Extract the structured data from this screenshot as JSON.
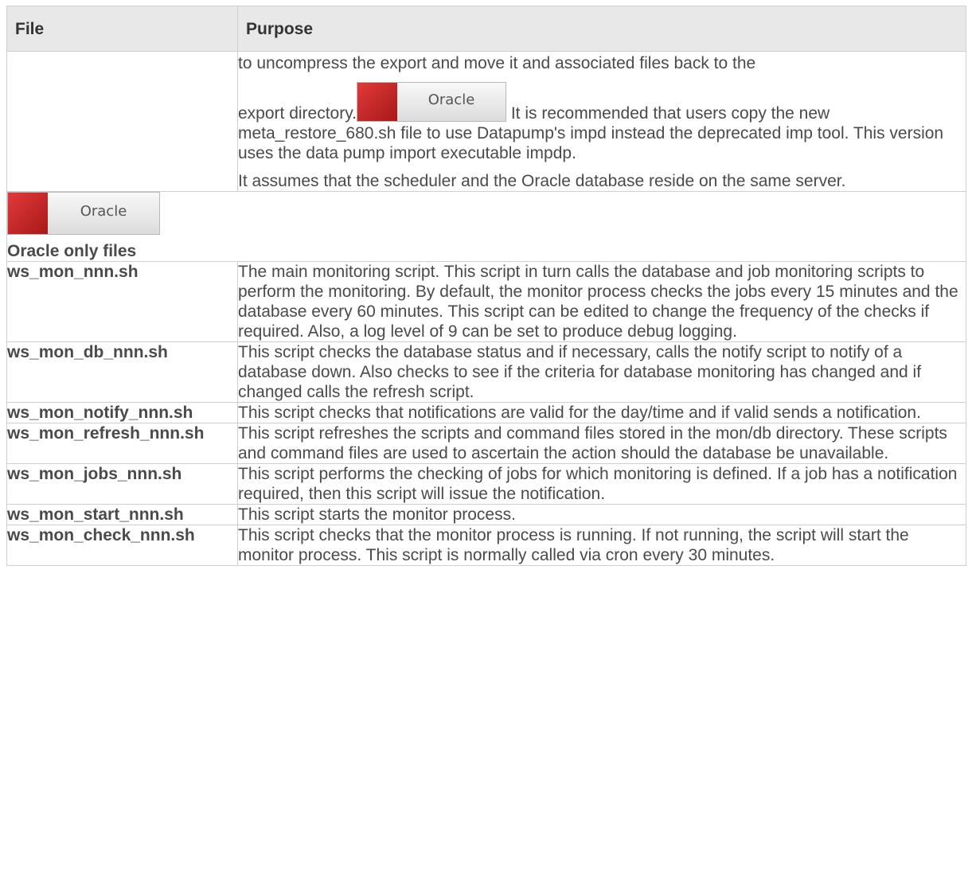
{
  "header": {
    "col_file": "File",
    "col_purpose": "Purpose"
  },
  "first_row": {
    "line1": "to uncompress the export and move it and associated files back to the",
    "before_badge": "export directory.",
    "after_badge": " It is recommended that users copy the new meta_restore_680.sh file to use Datapump's impd instead the deprecated imp tool. This version uses the data pump import executable impdp.",
    "para2": "It assumes that the scheduler and the Oracle database reside on the same server."
  },
  "badge": {
    "label": "Oracle",
    "red": "#c62828"
  },
  "section": {
    "title": "Oracle only files"
  },
  "rows": [
    {
      "file": "ws_mon_nnn.sh",
      "purpose": "The main monitoring script. This script in turn calls the database and job monitoring scripts to perform the monitoring. By default, the monitor process checks the jobs every 15 minutes and the database every 60 minutes. This script can be edited to change the frequency of the checks if required. Also, a log level of 9 can be set to produce debug logging."
    },
    {
      "file": "ws_mon_db_nnn.sh",
      "purpose": "This script checks the database status and if necessary, calls the notify script to notify of a database down. Also checks to see if the criteria for database monitoring has changed and if changed calls the refresh script."
    },
    {
      "file": "ws_mon_notify_nnn.sh",
      "purpose": "This script checks that notifications are valid for the day/time and if valid sends a notification."
    },
    {
      "file": "ws_mon_refresh_nnn.sh",
      "purpose": "This script refreshes the scripts and command files stored in the mon/db directory. These scripts and command files are used to ascertain the action should the database be unavailable."
    },
    {
      "file": "ws_mon_jobs_nnn.sh",
      "purpose": "This script performs the checking of jobs for which monitoring is defined. If a job has a notification required, then this script will issue the notification."
    },
    {
      "file": "ws_mon_start_nnn.sh",
      "purpose": "This script starts the monitor process."
    },
    {
      "file": "ws_mon_check_nnn.sh",
      "purpose": "This script checks that the monitor process is running. If not running, the script will start the monitor process. This script is normally called via cron every 30 minutes."
    }
  ]
}
